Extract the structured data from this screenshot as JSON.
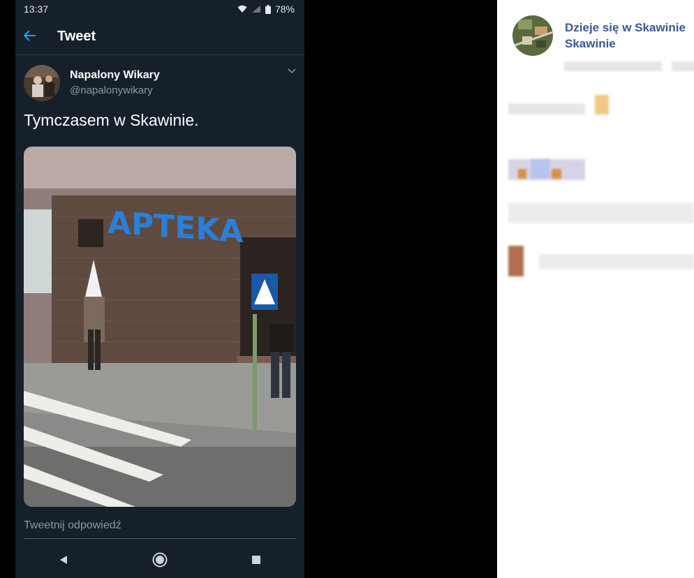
{
  "status_bar": {
    "time": "13:37",
    "battery": "78%"
  },
  "header": {
    "title": "Tweet"
  },
  "tweet": {
    "display_name": "Napalony Wikary",
    "handle": "@napalonywikary",
    "text": "Tymczasem w Skawinie.",
    "photo_sign": "APTEKA"
  },
  "reply": {
    "placeholder": "Tweetnij odpowiedź"
  },
  "facebook": {
    "title_line1": "Dzieje się w Skawinie",
    "title_line2": "Skawinie"
  },
  "colors": {
    "twitter_bg": "#15202b",
    "twitter_blue": "#1da1f2",
    "facebook_link": "#385898"
  }
}
